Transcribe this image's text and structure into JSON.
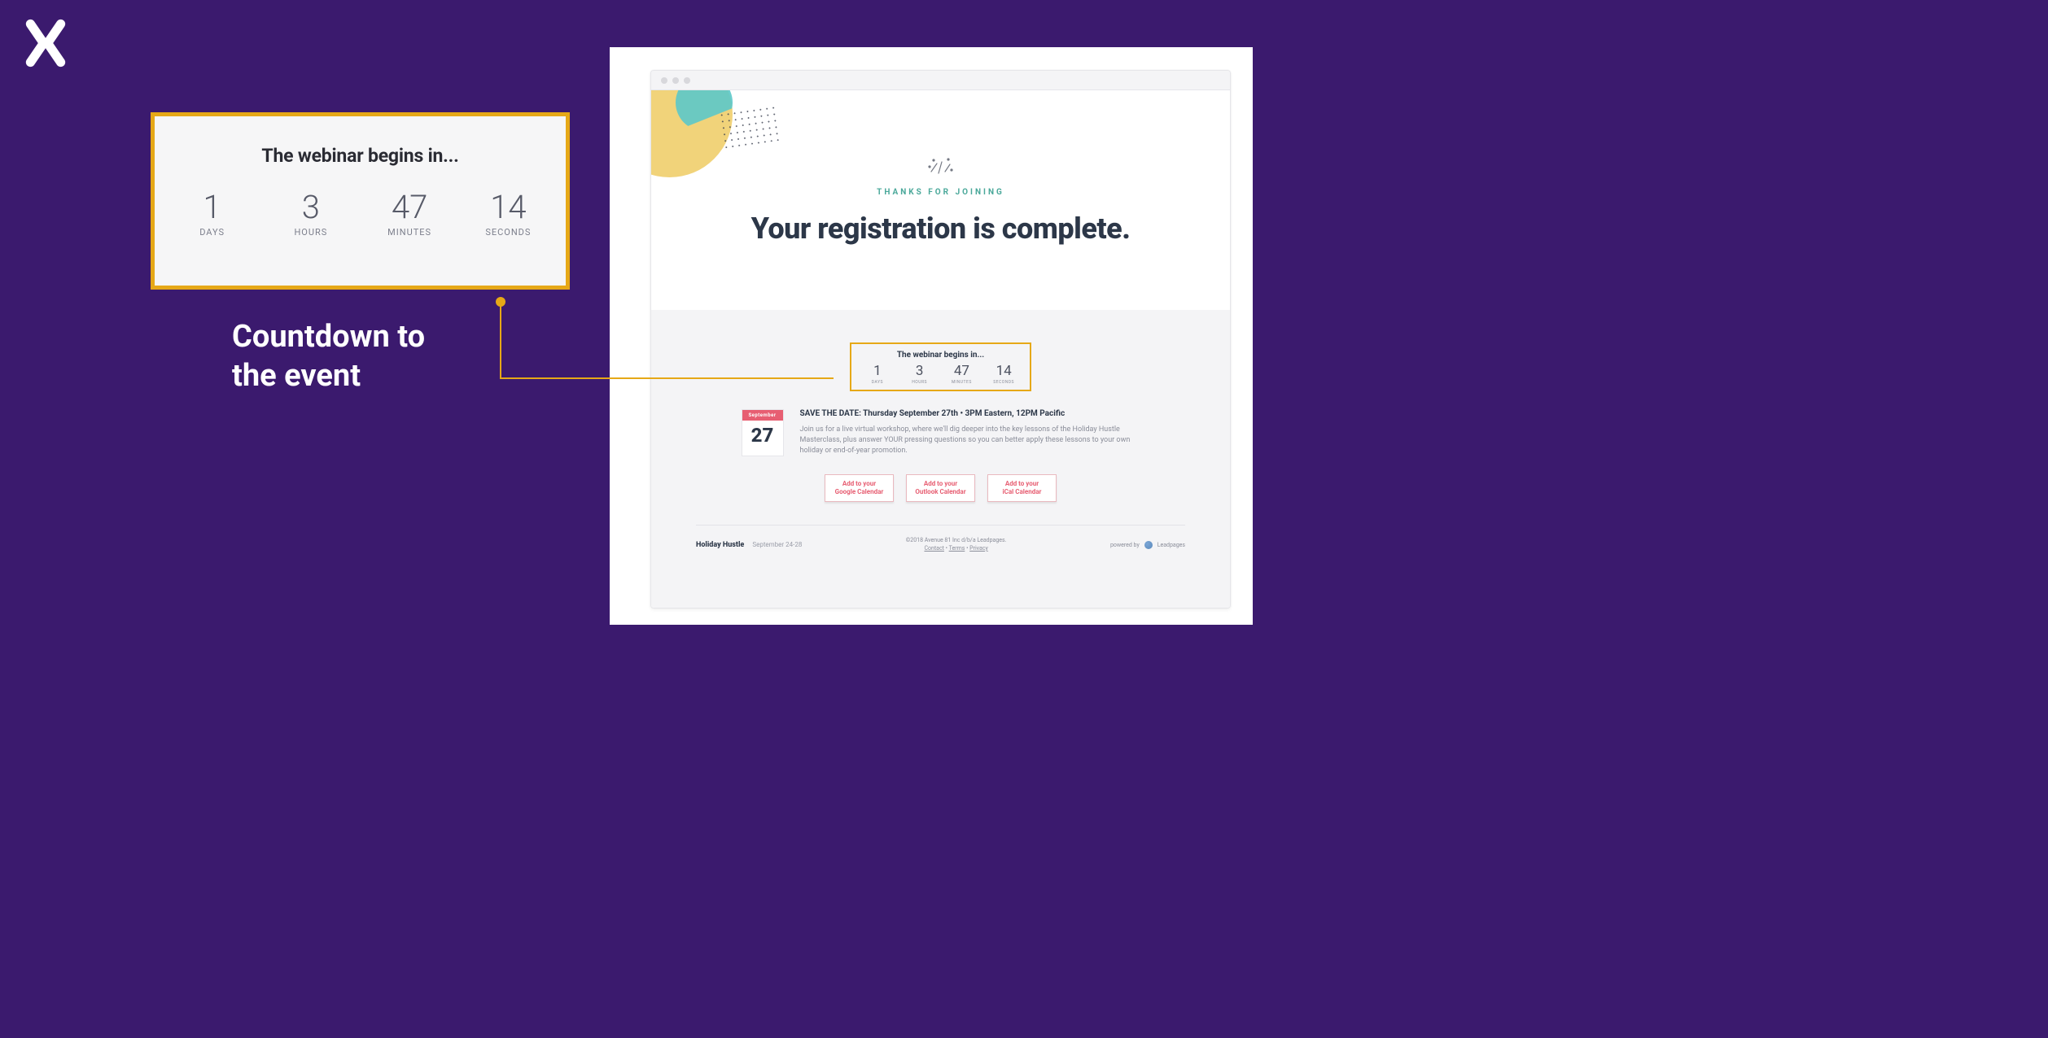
{
  "annotation": {
    "caption_line1": "Countdown to",
    "caption_line2": "the event"
  },
  "countdown": {
    "title": "The webinar begins in...",
    "units": [
      {
        "value": "1",
        "label": "DAYS"
      },
      {
        "value": "3",
        "label": "HOURS"
      },
      {
        "value": "47",
        "label": "MINUTES"
      },
      {
        "value": "14",
        "label": "SECONDS"
      }
    ]
  },
  "page": {
    "eyebrow": "THANKS FOR JOINING",
    "headline": "Your registration is complete.",
    "calendar": {
      "month": "September",
      "day": "27"
    },
    "save_date_heading": "SAVE THE DATE: Thursday September 27th • 3PM Eastern, 12PM Pacific",
    "save_date_body": "Join us for a live virtual workshop, where we'll dig deeper into the key lessons of the Holiday Hustle Masterclass, plus answer YOUR pressing questions so you can better apply these lessons to your own holiday or end-of-year promotion.",
    "buttons": [
      {
        "line1": "Add to your",
        "line2": "Google Calendar"
      },
      {
        "line1": "Add to your",
        "line2": "Outlook Calendar"
      },
      {
        "line1": "Add to your",
        "line2": "iCal Calendar"
      }
    ],
    "footer": {
      "brand": "Holiday Hustle",
      "dates": "September 24-28",
      "copyright": "©2018 Avenue 81 Inc d/b/a Leadpages.",
      "links": [
        "Contact",
        "Terms",
        "Privacy"
      ],
      "powered_prefix": "powered by",
      "powered_brand": "Leadpages"
    }
  }
}
